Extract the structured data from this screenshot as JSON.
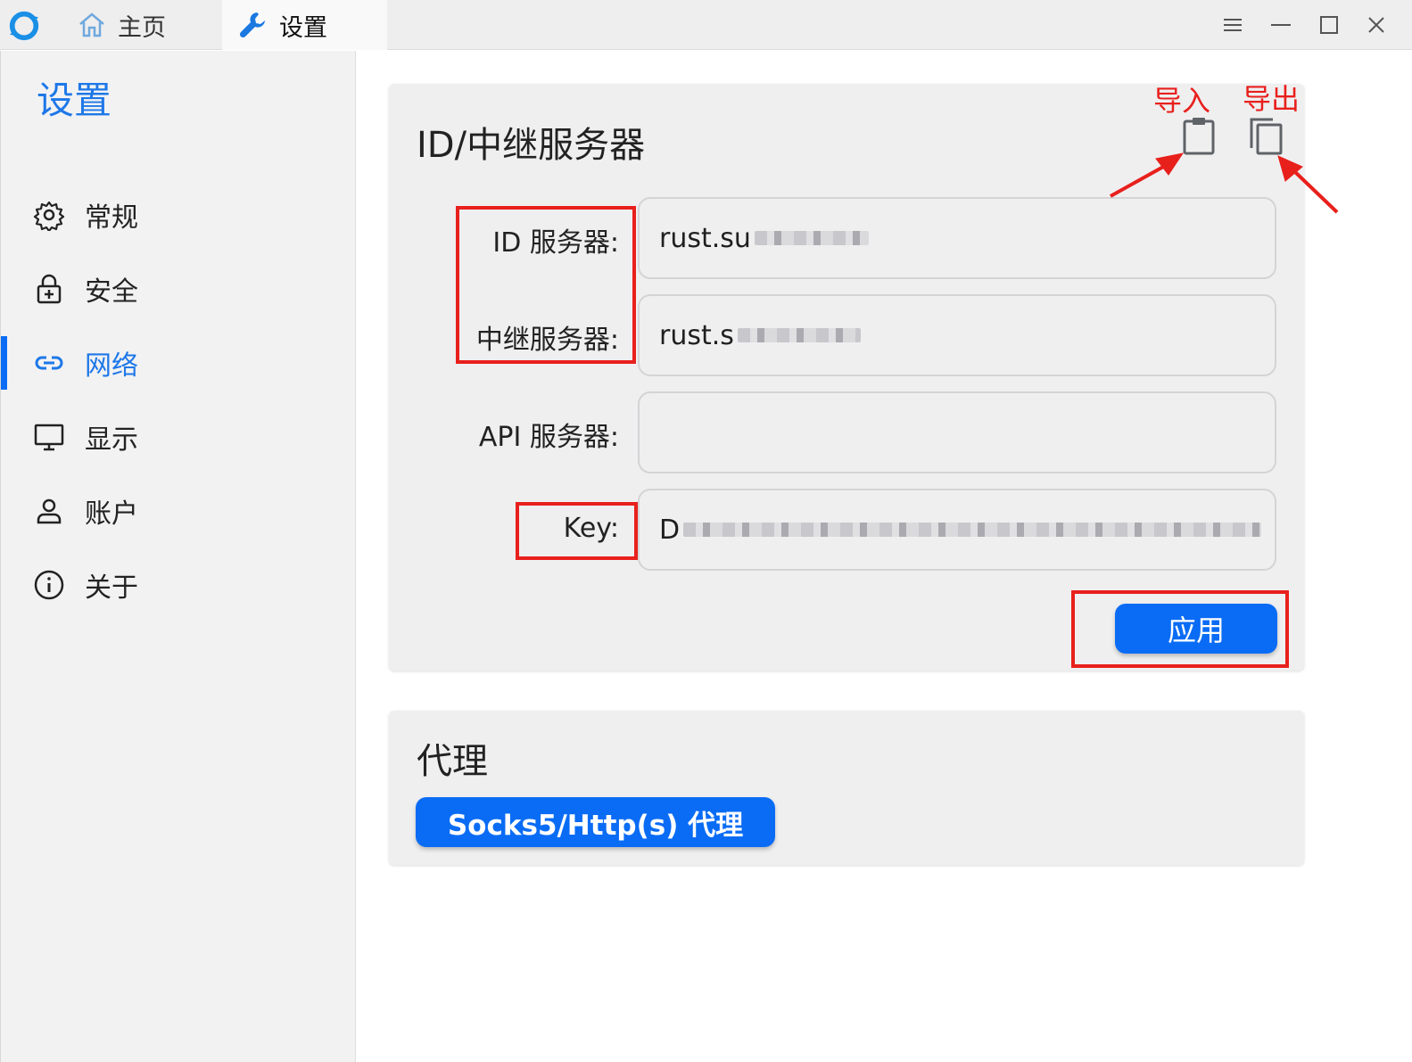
{
  "titlebar": {
    "tabs": [
      {
        "label": "主页",
        "icon": "home-icon"
      },
      {
        "label": "设置",
        "icon": "wrench-icon"
      }
    ],
    "controls": [
      "menu-icon",
      "minimize-icon",
      "maximize-icon",
      "close-icon"
    ]
  },
  "sidebar": {
    "title": "设置",
    "items": [
      {
        "label": "常规",
        "icon": "gear-icon"
      },
      {
        "label": "安全",
        "icon": "lock-icon"
      },
      {
        "label": "网络",
        "icon": "link-icon",
        "active": true
      },
      {
        "label": "显示",
        "icon": "monitor-icon"
      },
      {
        "label": "账户",
        "icon": "user-icon"
      },
      {
        "label": "关于",
        "icon": "info-icon"
      }
    ]
  },
  "server_card": {
    "title": "ID/中继服务器",
    "fields": [
      {
        "label": "ID 服务器:",
        "value": "rust.su"
      },
      {
        "label": "中继服务器:",
        "value": "rust.s"
      },
      {
        "label": "API 服务器:",
        "value": ""
      },
      {
        "label": "Key:",
        "value": "D"
      }
    ],
    "apply_label": "应用",
    "import_icon": "clipboard-icon",
    "export_icon": "copy-icon"
  },
  "proxy_card": {
    "title": "代理",
    "button_label": "Socks5/Http(s) 代理"
  },
  "annotations": {
    "import_label": "导入",
    "export_label": "导出",
    "color": "#e8201c"
  },
  "colors": {
    "accent": "#0a6cf5",
    "sidebar_active": "#1e78e8"
  }
}
